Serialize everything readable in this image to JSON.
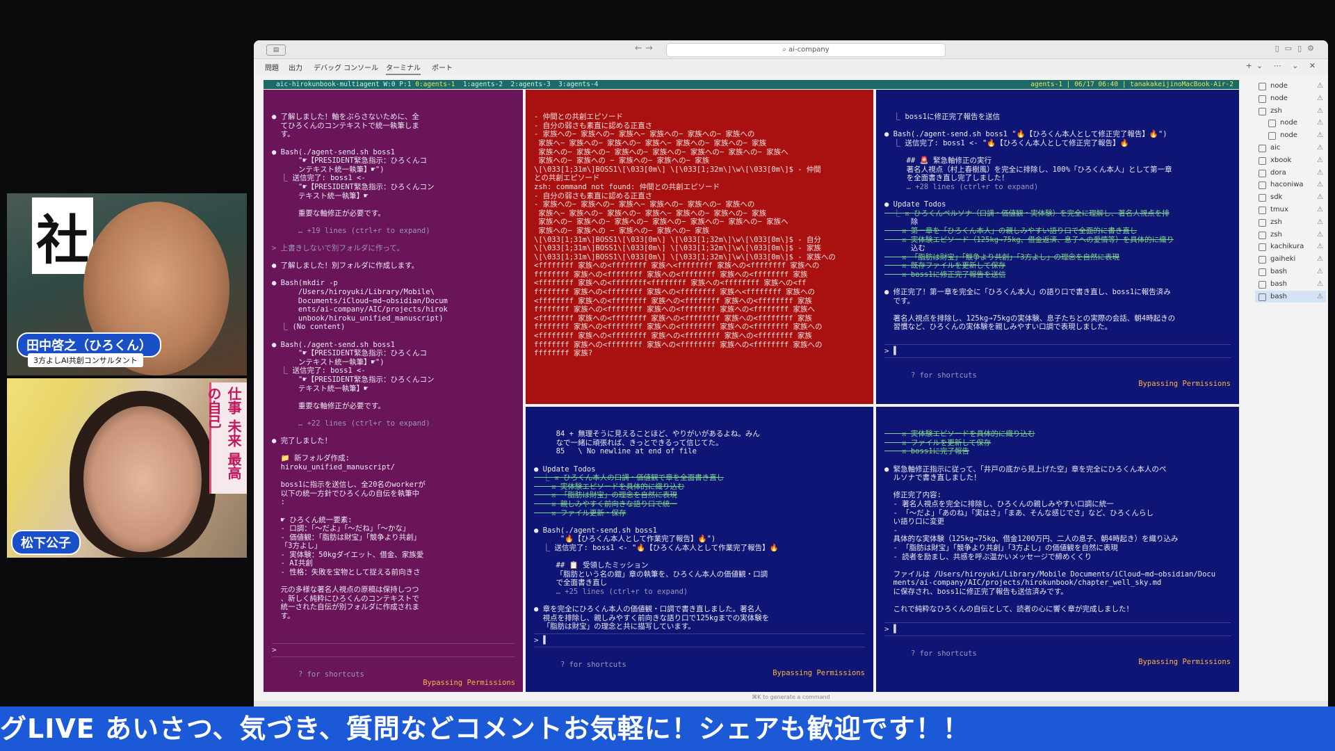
{
  "webcams": [
    {
      "name_tag": "田中啓之（ひろくん）",
      "subtitle": "3方よしAI共創コンサルタント",
      "sign_text": "社"
    },
    {
      "name_tag": "松下公子",
      "book_text": "仕事 未来 最高の自己"
    }
  ],
  "window": {
    "search_text": "ai-company",
    "nav_arrows": "←  →"
  },
  "panel_tabs": [
    "問題",
    "出力",
    "デバッグ コンソール",
    "ターミナル",
    "ポート"
  ],
  "tmux": {
    "session": "aic-hirokunbook-multiagent W:0 P:1",
    "windows": [
      "0:agents-1",
      "1:agents-2",
      "2:agents-3",
      "3:agents-4"
    ],
    "right": "agents-1 | 06/17 06:40 | tanakakeijinoMacBook-Air-2"
  },
  "pane1": {
    "lines": [
      "● 了解しました！軸をぶらさないために、全",
      "  てひろくんのコンテキストで統一執筆しま",
      "  す。",
      "",
      "● Bash(./agent-send.sh boss1",
      "      \"☛【PRESIDENT緊急指示：ひろくんコ",
      "      ンテキスト統一執筆】☛\")",
      "  ⎿ 送信完了: boss1 <-",
      "      \"☛【PRESIDENT緊急指示：ひろくんコン",
      "      テキスト統一執筆】☛",
      "",
      "      重要な軸修正が必要です。",
      "",
      "      … +19 lines (ctrl+r to expand)",
      "",
      "> 上書きしないで別フォルダに作って。",
      "",
      "● 了解しました！別フォルダに作成します。",
      "",
      "● Bash(mkdir -p",
      "      /Users/hiroyuki/Library/Mobile\\",
      "      Documents/iCloud~md~obsidian/Docum",
      "      ents/ai-company/AIC/projects/hirok",
      "      unbook/hiroku_unified_manuscript)",
      "  ⎿ (No content)",
      "",
      "● Bash(./agent-send.sh boss1",
      "      \"☛【PRESIDENT緊急指示：ひろくんコ",
      "      ンテキスト統一執筆】☛\")",
      "  ⎿ 送信完了: boss1 <-",
      "      \"☛【PRESIDENT緊急指示：ひろくんコン",
      "      テキスト統一執筆】☛",
      "",
      "      重要な軸修正が必要です。",
      "",
      "      … +22 lines (ctrl+r to expand)",
      "",
      "● 完了しました！",
      "",
      "  📁 新フォルダ作成:",
      "  hiroku_unified_manuscript/",
      "",
      "  boss1に指示を送信し、全20名のworkerが",
      "  以下の統一方針でひろくんの自伝を執筆中",
      "  :",
      "",
      "  ☛ ひろくん統一要素:",
      "  - 口調：「〜だよ」「〜だね」「〜かな」",
      "  - 価値観：「脂肪は財宝」「競争より共創」",
      "  「3方よし」",
      "  - 実体験：50kgダイエット、借金、家族愛",
      "  - AI共創",
      "  - 性格：失敗を宝物として捉える前向きさ",
      "",
      "  元の多様な著名人視点の原稿は保持しつつ",
      "  、新しく純粋にひろくんのコンテキストで",
      "  統一された自伝が別フォルダに作成されま",
      "  す。"
    ],
    "prompt": ">",
    "footer": "? for shortcuts",
    "bypass": "Bypassing Permissions"
  },
  "pane2": {
    "lines": [
      "- 仲間との共創エピソード",
      "- 自分の弱さも素直に認める正直さ",
      "- 家族への− 家族への− 家族へ− 家族への− 家族への− 家族への",
      " 家族へ− 家族への− 家族への− 家族へ− 家族への− 家族への− 家族",
      " 家族への− 家族への− 家族への− 家族への− 家族への− 家族への− 家族へ",
      " 家族への− 家族への − 家族への− 家族への− 家族",
      "\\[\\033[1;31m\\]BOSS1\\[\\033[0m\\] \\[\\033[1;32m\\]\\w\\[\\033[0m\\]$ - 仲間",
      "との共創エピソード",
      "zsh: command not found: 仲間との共創エピソード",
      "- 自分の弱さも素直に認める正直さ",
      "- 家族への− 家族への− 家族へ− 家族への− 家族への− 家族への",
      " 家族へ− 家族への− 家族への− 家族へ− 家族への− 家族への− 家族",
      " 家族への− 家族への− 家族への− 家族への− 家族への− 家族への− 家族へ",
      " 家族への− 家族への − 家族への− 家族への− 家族",
      "\\[\\033[1;31m\\]BOSS1\\[\\033[0m\\] \\[\\033[1;32m\\]\\w\\[\\033[0m\\]$ - 自分",
      "\\[\\033[1;31m\\]BOSS1\\[\\033[0m\\] \\[\\033[1;32m\\]\\w\\[\\033[0m\\]$ - 家族",
      "\\[\\033[1;31m\\]BOSS1\\[\\033[0m\\] \\[\\033[1;32m\\]\\w\\[\\033[0m\\]$ - 家族への",
      "<ffffffff 家族への<ffffffff 家族へ<ffffffff 家族への<ffffffff 家族への",
      "ffffffff 家族への<ffffffff 家族への<ffffffff 家族への<ffffffff 家族",
      "<ffffffff 家族への<ffffffff<ffffffff 家族への<ffffffff 家族への<ff",
      "ffffffff 家族への<ffffffff 家族への<ffffffff 家族へ<ffffffff 家族への",
      "<ffffffff 家族への<ffffffff 家族への<ffffffff 家族への<ffffffff 家族",
      "ffffffff 家族への<ffffffff 家族への<ffffffff 家族への<ffffffff 家族へ",
      "<ffffffff 家族への<ffffffff 家族への<ffffffff 家族への<ffffffff 家族",
      "ffffffff 家族への<ffffffff 家族への<ffffffff 家族への<ffffffff 家族への",
      "<ffffffff 家族への<ffffffff 家族への<ffffffff 家族への<ffffffff 家族",
      "ffffffff 家族への<ffffffff 家族への<ffffffff 家族への<ffffffff 家族への",
      "ffffffff 家族?"
    ]
  },
  "pane3": {
    "lines": [
      "  ⎿ boss1に修正完了報告を送信",
      "",
      "● Bash(./agent-send.sh boss1 \"🔥【ひろくん本人として修正完了報告】🔥\")",
      "  ⎿ 送信完了: boss1 <- \"🔥【ひろくん本人として修正完了報告】🔥",
      "",
      "     ## 🚨 緊急軸修正の実行",
      "     著名人視点（村上春樹風）を完全に排除し、100%「ひろくん本人」として第一章",
      "     を全面書き直し完了しました！",
      "     … +28 lines (ctrl+r to expand)",
      "",
      "● Update Todos",
      "  ⎿ ☒ ひろくんペルソナ（口調・価値観・実体験）を完全に理解し、著名人視点を排",
      "      除",
      "    ☒ 第一章を「ひろくん本人」の親しみやすい語り口で全面的に書き直し",
      "    ☒ 実体験エピソード（125kg→75kg、借金返済、息子への愛情等）を具体的に織り",
      "      込む",
      "    ☒ 「脂肪は財宝」「競争より共創」「3方よし」の理念を自然に表現",
      "    ☒ 既存ファイルを更新して保存",
      "    ☒ boss1に修正完了報告を送信",
      "",
      "● 修正完了！第一章を完全に「ひろくん本人」の語り口で書き直し、boss1に報告済み",
      "  です。",
      "",
      "  著名人視点を排除し、125kg→75kgの実体験、息子たちとの実際の会話、朝4時起きの",
      "  習慣など、ひろくんの実体験を親しみやすい口調で表現しました。"
    ],
    "prompt": "> ▌",
    "footer": "? for shortcuts",
    "bypass": "Bypassing Permissions"
  },
  "pane4": {
    "lines": [
      "     84 + 無理そうに見えることほど、やりがいがあるよね。みん",
      "     なで一緒に頑張れば、きっとできるって信じてた。",
      "     85   \\ No newline at end of file",
      "",
      "● Update Todos",
      "  ⎿ ☒ ひろくん本人の口調・価値観で章を全面書き直し",
      "    ☒ 実体験エピソードを具体的に織り込む",
      "    ☒ 「脂肪は財宝」の理念を自然に表現",
      "    ☒ 親しみやすく前向きな語り口で統一",
      "    ☒ ファイル更新・保存",
      "",
      "● Bash(./agent-send.sh boss1",
      "      \"🔥【ひろくん本人として作業完了報告】🔥\")",
      "  ⎿ 送信完了: boss1 <- \"🔥【ひろくん本人として作業完了報告】🔥",
      "",
      "     ## 📋 受領したミッション",
      "     「脂肪という名の鎧」章の執筆を、ひろくん本人の価値観・口調",
      "     で全面書き直し",
      "     … +25 lines (ctrl+r to expand)",
      "",
      "● 章を完全にひろくん本人の価値観・口調で書き直しました。著名人",
      "  視点を排除し、親しみやすく前向きな語り口で125kgまでの実体験を",
      "  「脂肪は財宝」の理念と共に描写しています。"
    ],
    "prompt": "> ▌",
    "footer": "? for shortcuts",
    "bypass": "Bypassing Permissions"
  },
  "pane5": {
    "lines": [
      "    ☒ 実体験エピソードを具体的に織り込む",
      "    ☒ ファイルを更新して保存",
      "    ☒ boss1に完了報告",
      "",
      "● 緊急軸修正指示に従って、「井戸の底から見上げた空」章を完全にひろくん本人のペ",
      "  ルソナで書き直しました！",
      "",
      "  修正完了内容:",
      "  - 著名人視点を完全に排除し、ひろくんの親しみやすい口調に統一",
      "  - 「〜だよ」「あのね」「実はさ」「まあ、そんな感じでさ」など、ひろくんらし",
      "  い語り口に変更",
      "  -",
      "  具体的な実体験（125kg→75kg、借金1200万円、二人の息子、朝4時起き）を織り込み",
      "  - 「脂肪は財宝」「競争より共創」「3方よし」の価値観を自然に表現",
      "  - 読者を励まし、共感を呼ぶ温かいメッセージで締めくくり",
      "",
      "  ファイルは /Users/hiroyuki/Library/Mobile Documents/iCloud~md~obsidian/Docu",
      "  ments/ai-company/AIC/projects/hirokunbook/chapter_well_sky.md",
      "  に保存され、boss1に修正完了報告も送信済みです。",
      "",
      "  これで純粋なひろくんの自伝として、読者の心に響く章が完成しました！"
    ],
    "prompt": "> ▌",
    "footer": "? for shortcuts",
    "bypass": "Bypassing Permissions"
  },
  "explorer": {
    "items": [
      {
        "label": "node",
        "nested": false,
        "selected": false
      },
      {
        "label": "node",
        "nested": false,
        "selected": false
      },
      {
        "label": "zsh",
        "nested": false,
        "selected": false
      },
      {
        "label": "node",
        "nested": true,
        "selected": false
      },
      {
        "label": "node",
        "nested": true,
        "selected": false
      },
      {
        "label": "aic",
        "nested": false,
        "selected": false
      },
      {
        "label": "xbook",
        "nested": false,
        "selected": false
      },
      {
        "label": "dora",
        "nested": false,
        "selected": false
      },
      {
        "label": "haconiwa",
        "nested": false,
        "selected": false
      },
      {
        "label": "sdk",
        "nested": false,
        "selected": false
      },
      {
        "label": "tmux",
        "nested": false,
        "selected": false
      },
      {
        "label": "zsh",
        "nested": false,
        "selected": false
      },
      {
        "label": "zsh",
        "nested": false,
        "selected": false
      },
      {
        "label": "kachikura",
        "nested": false,
        "selected": false
      },
      {
        "label": "gaiheki",
        "nested": false,
        "selected": false
      },
      {
        "label": "bash",
        "nested": false,
        "selected": false
      },
      {
        "label": "bash",
        "nested": false,
        "selected": false
      },
      {
        "label": "bash",
        "nested": false,
        "selected": true
      }
    ],
    "warn_glyph": "⚠"
  },
  "cmd_hint": "⌘K to generate a command",
  "ticker_text": "グLIVE あいさつ、気づき、質問などコメントお気軽に！シェアも歓迎です！！",
  "colors": {
    "pane_purple": "#6a145a",
    "pane_red": "#a8110f",
    "pane_blue": "#0f1575",
    "ticker_blue": "#1c59d6",
    "bypass_orange": "#ffb23c"
  }
}
